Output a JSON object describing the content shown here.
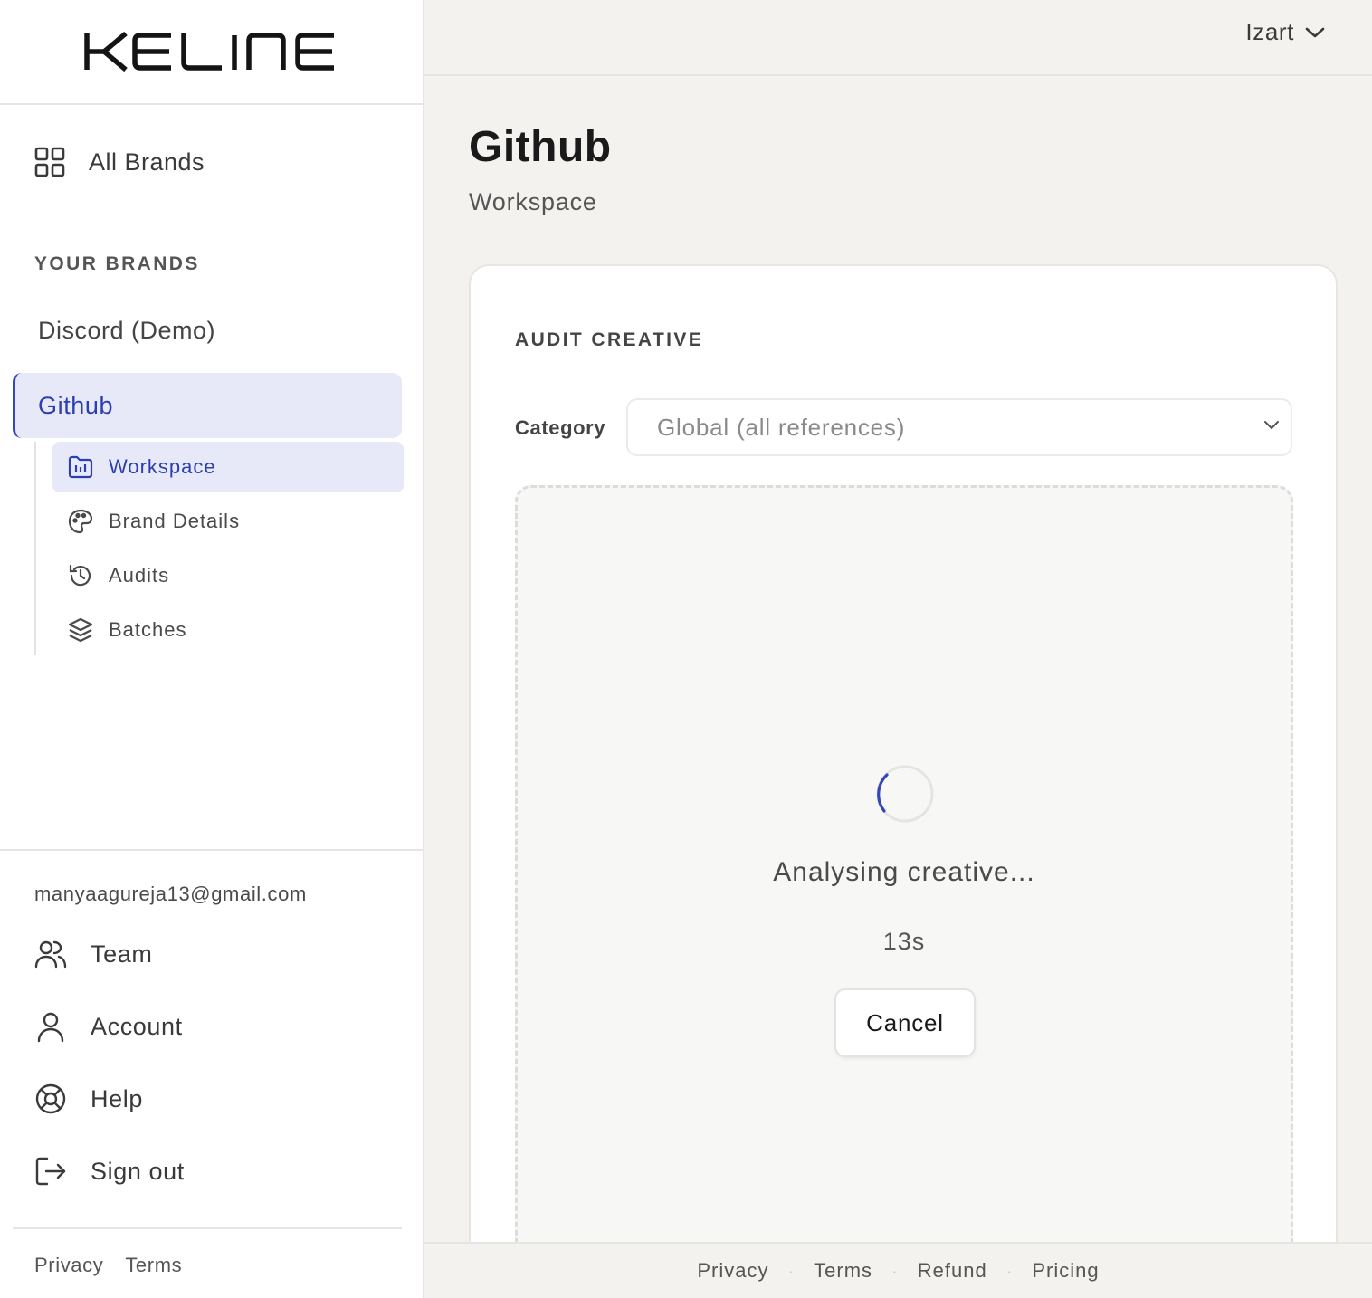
{
  "brand_logo_text": "KELINE",
  "sidebar": {
    "all_brands_label": "All Brands",
    "section_title": "YOUR BRANDS",
    "brands": [
      {
        "label": "Discord (Demo)"
      },
      {
        "label": "Github"
      }
    ],
    "sub_items": [
      {
        "label": "Workspace",
        "icon": "folder-chart-icon"
      },
      {
        "label": "Brand Details",
        "icon": "palette-icon"
      },
      {
        "label": "Audits",
        "icon": "history-icon"
      },
      {
        "label": "Batches",
        "icon": "layers-icon"
      }
    ],
    "user_email": "manyaagureja13@gmail.com",
    "bottom_items": [
      {
        "label": "Team",
        "icon": "users-icon"
      },
      {
        "label": "Account",
        "icon": "user-icon"
      },
      {
        "label": "Help",
        "icon": "lifebuoy-icon"
      },
      {
        "label": "Sign out",
        "icon": "sign-out-icon"
      }
    ],
    "footer_links": [
      "Privacy",
      "Terms"
    ]
  },
  "topbar": {
    "user_name": "Izart"
  },
  "main": {
    "title": "Github",
    "subtitle": "Workspace",
    "card": {
      "title": "AUDIT CREATIVE",
      "category_label": "Category",
      "category_value": "Global (all references)",
      "status_text": "Analysing creative...",
      "elapsed": "13s",
      "cancel_label": "Cancel"
    }
  },
  "footer": {
    "links": [
      "Privacy",
      "Terms",
      "Refund",
      "Pricing"
    ],
    "separator": "·"
  },
  "colors": {
    "accent": "#3446b8",
    "accent_bg": "#e7e9f8",
    "background": "#f3f2ef"
  }
}
